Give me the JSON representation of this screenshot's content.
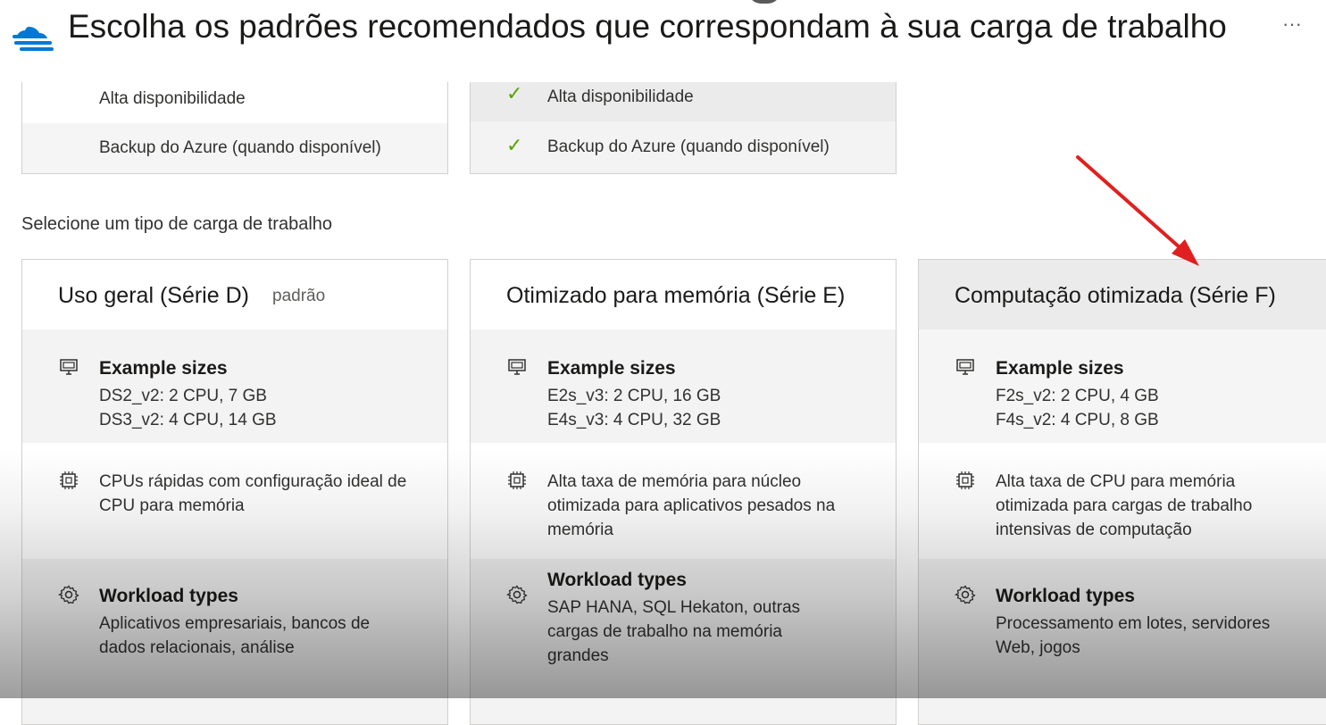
{
  "header": {
    "title": "Escolha os padrões recomendados que correspondam à sua carga de trabalho",
    "more_label": "···",
    "logo_icon": "cloud-stack-icon",
    "brand_color": "#0078d4"
  },
  "top_cards": [
    {
      "rows": [
        {
          "label": "Alta disponibilidade",
          "checked": false
        },
        {
          "label": "Backup do Azure (quando disponível)",
          "checked": false
        }
      ]
    },
    {
      "rows": [
        {
          "label": "Alta disponibilidade",
          "checked": true
        },
        {
          "label": "Backup do Azure (quando disponível)",
          "checked": true
        }
      ]
    }
  ],
  "check_symbol": "✓",
  "section_label": "Selecione um tipo de carga de trabalho",
  "cards": [
    {
      "title": "Uso geral (Série D)",
      "tag": "padrão",
      "sizes_heading": "Example sizes",
      "sizes": [
        "DS2_v2: 2 CPU, 7 GB",
        "DS3_v2: 4 CPU, 14 GB"
      ],
      "cpu_text": "CPUs rápidas com configuração ideal de CPU para memória",
      "workload_heading": "Workload types",
      "workload_text": "Aplicativos empresariais, bancos de dados relacionais, análise"
    },
    {
      "title": "Otimizado para memória (Série E)",
      "sizes_heading": "Example sizes",
      "sizes": [
        "E2s_v3: 2 CPU, 16 GB",
        "E4s_v3: 4 CPU, 32 GB"
      ],
      "cpu_text": "Alta taxa de memória para núcleo otimizada para aplicativos pesados na memória",
      "workload_heading": "Workload types",
      "workload_text": "SAP HANA, SQL Hekaton, outras cargas de trabalho na memória grandes"
    },
    {
      "title": "Computação otimizada (Série F)",
      "sizes_heading": "Example sizes",
      "sizes": [
        "F2s_v2: 2 CPU, 4 GB",
        "F4s_v2: 4 CPU, 8 GB"
      ],
      "cpu_text": "Alta taxa de CPU para memória otimizada para cargas de trabalho intensivas de computação",
      "workload_heading": "Workload types",
      "workload_text": "Processamento em lotes, servidores Web, jogos",
      "selected": true
    }
  ],
  "annotation": {
    "arrow_color": "#e02020"
  }
}
